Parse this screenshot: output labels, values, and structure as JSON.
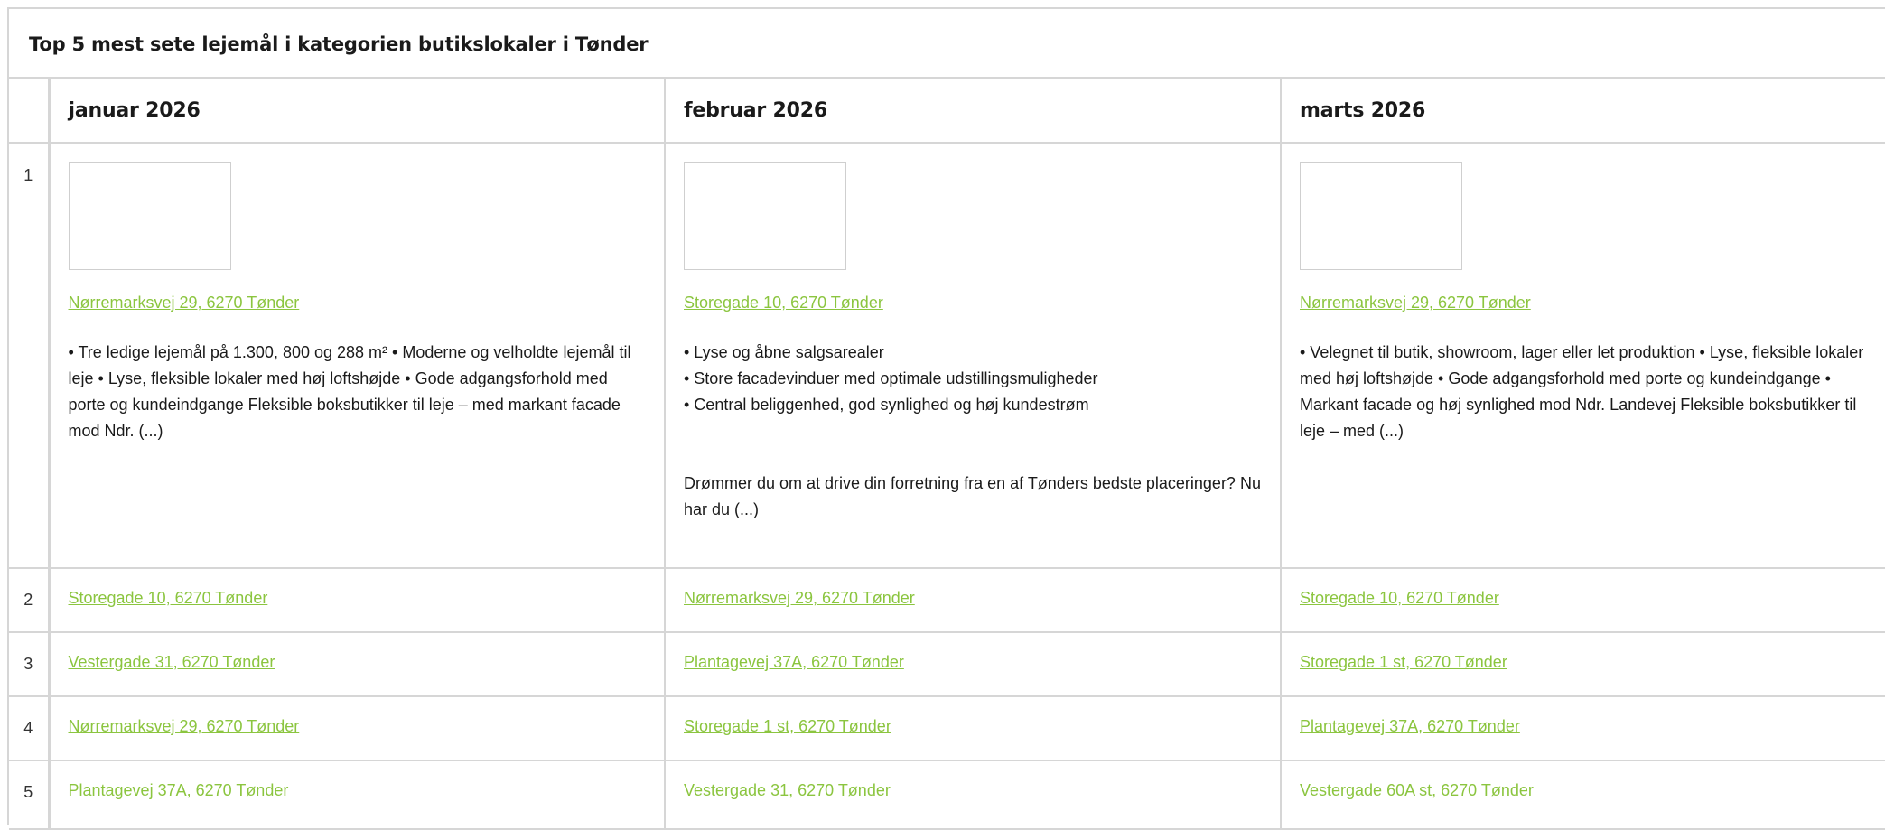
{
  "title": "Top 5 mest sete lejemål i kategorien butikslokaler i Tønder",
  "columns": [
    "januar 2026",
    "februar 2026",
    "marts 2026"
  ],
  "rows": [
    {
      "rank": "1",
      "cells": [
        {
          "address": "Nørremarksvej 29, 6270 Tønder",
          "description": "• Tre ledige lejemål på 1.300, 800 og 288 m² • Moderne og velholdte lejemål til leje • Lyse, fleksible lokaler med høj loftshøjde • Gode adgangsforhold med porte og kundeindgange Fleksible boksbutikker til leje – med markant facade mod Ndr. (...)"
        },
        {
          "address": "Storegade 10, 6270 Tønder",
          "description": "• Lyse og åbne salgsarealer\n• Store facadevinduer med optimale udstillingsmuligheder\n• Central beliggenhed, god synlighed og høj kundestrøm\n\n\nDrømmer du om at drive din forretning fra en af Tønders bedste placeringer? Nu har du (...)"
        },
        {
          "address": "Nørremarksvej 29, 6270 Tønder",
          "description": "• Velegnet til butik, showroom, lager eller let produktion • Lyse, fleksible lokaler med høj loftshøjde • Gode adgangsforhold med porte og kundeindgange • Markant facade og høj synlighed mod Ndr. Landevej Fleksible boksbutikker til leje – med (...)"
        }
      ]
    },
    {
      "rank": "2",
      "cells": [
        {
          "address": "Storegade 10, 6270 Tønder"
        },
        {
          "address": "Nørremarksvej 29, 6270 Tønder"
        },
        {
          "address": "Storegade 10, 6270 Tønder"
        }
      ]
    },
    {
      "rank": "3",
      "cells": [
        {
          "address": "Vestergade 31, 6270 Tønder"
        },
        {
          "address": "Plantagevej 37A, 6270 Tønder"
        },
        {
          "address": "Storegade 1 st, 6270 Tønder"
        }
      ]
    },
    {
      "rank": "4",
      "cells": [
        {
          "address": "Nørremarksvej 29, 6270 Tønder"
        },
        {
          "address": "Storegade 1 st, 6270 Tønder"
        },
        {
          "address": "Plantagevej 37A, 6270 Tønder"
        }
      ]
    },
    {
      "rank": "5",
      "cells": [
        {
          "address": "Plantagevej 37A, 6270 Tønder"
        },
        {
          "address": "Vestergade 31, 6270 Tønder"
        },
        {
          "address": "Vestergade 60A st, 6270 Tønder"
        }
      ]
    }
  ],
  "colors": {
    "link": "#8bc53f",
    "border": "#d6d6d6",
    "text": "#1a1a1a"
  }
}
